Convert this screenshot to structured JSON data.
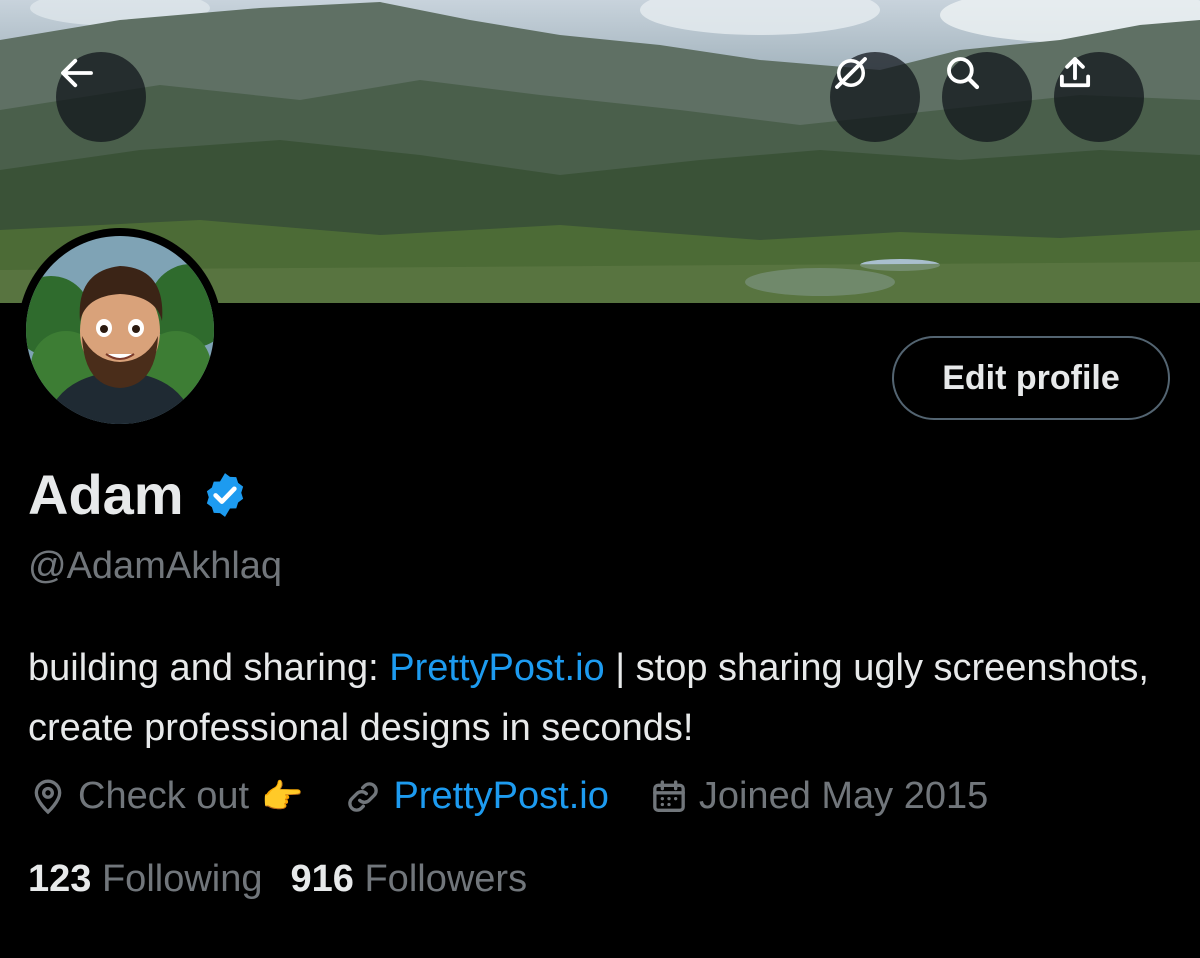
{
  "header": {
    "back_icon": "arrow-left-icon",
    "actions": [
      "grok-icon",
      "search-icon",
      "share-icon"
    ]
  },
  "profile": {
    "name": "Adam",
    "verified": true,
    "handle": "@AdamAkhlaq",
    "edit_label": "Edit profile",
    "bio": {
      "prefix": "building and sharing: ",
      "link": "PrettyPost.io",
      "suffix": " | stop sharing ugly screenshots, create professional designs in seconds!"
    },
    "location": "Check out",
    "location_emoji": "👉",
    "website": "PrettyPost.io",
    "joined": "Joined May 2015"
  },
  "stats": {
    "following_count": "123",
    "following_label": "Following",
    "followers_count": "916",
    "followers_label": "Followers"
  },
  "colors": {
    "background": "#000000",
    "text": "#e7e9ea",
    "muted": "#71767b",
    "link": "#1d9bf0"
  }
}
